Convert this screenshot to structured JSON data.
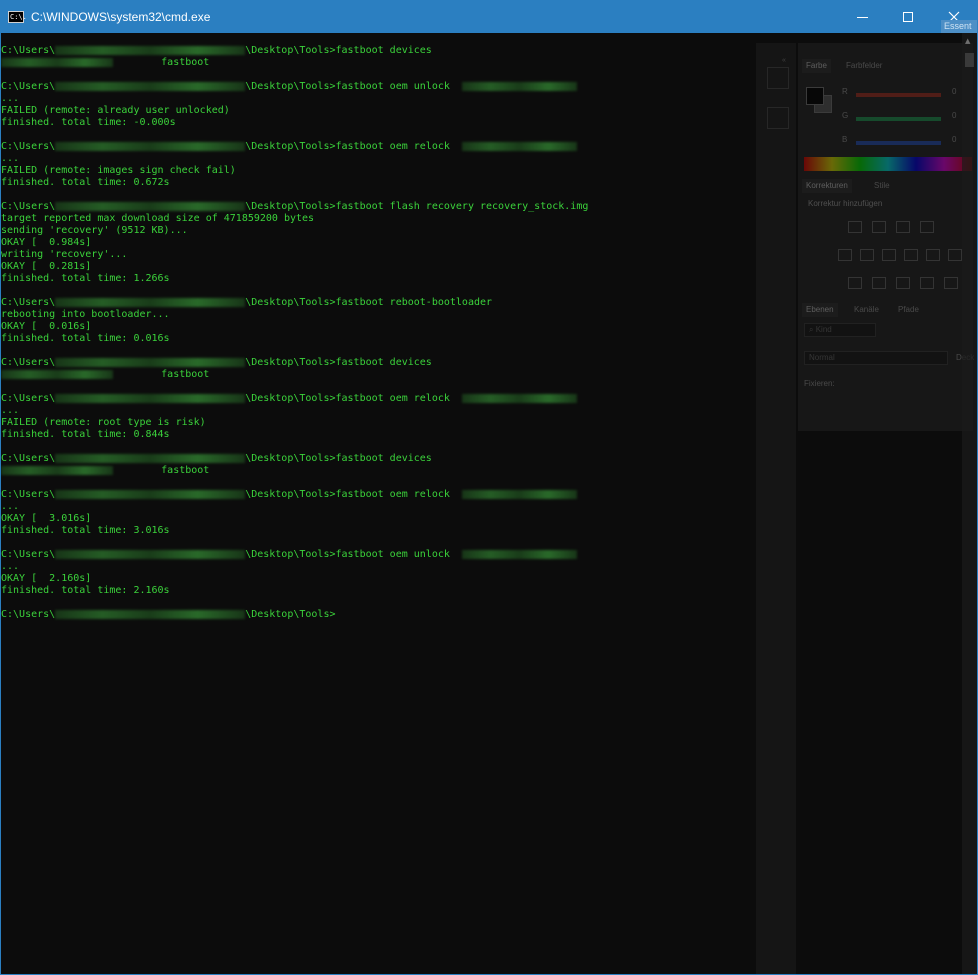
{
  "window": {
    "title": "C:\\WINDOWS\\system32\\cmd.exe",
    "icon_text": "C:\\.",
    "essentials_label": "Essent"
  },
  "terminal": {
    "lines": [
      {
        "parts": [
          {
            "t": "C:\\Users\\"
          },
          {
            "blur": 190
          },
          {
            "t": "\\Desktop\\Tools>fastboot devices"
          }
        ]
      },
      {
        "parts": [
          {
            "blur": 112
          },
          {
            "t": "        fastboot"
          }
        ]
      },
      {
        "parts": []
      },
      {
        "parts": [
          {
            "t": "C:\\Users\\"
          },
          {
            "blur": 190
          },
          {
            "t": "\\Desktop\\Tools>fastboot oem unlock  "
          },
          {
            "blur": 115
          }
        ]
      },
      {
        "parts": [
          {
            "t": "..."
          }
        ]
      },
      {
        "parts": [
          {
            "t": "FAILED (remote: already user unlocked)"
          }
        ]
      },
      {
        "parts": [
          {
            "t": "finished. total time: -0.000s"
          }
        ]
      },
      {
        "parts": []
      },
      {
        "parts": [
          {
            "t": "C:\\Users\\"
          },
          {
            "blur": 190
          },
          {
            "t": "\\Desktop\\Tools>fastboot oem relock  "
          },
          {
            "blur": 115
          }
        ]
      },
      {
        "parts": [
          {
            "t": "..."
          }
        ]
      },
      {
        "parts": [
          {
            "t": "FAILED (remote: images sign check fail)"
          }
        ]
      },
      {
        "parts": [
          {
            "t": "finished. total time: 0.672s"
          }
        ]
      },
      {
        "parts": []
      },
      {
        "parts": [
          {
            "t": "C:\\Users\\"
          },
          {
            "blur": 190
          },
          {
            "t": "\\Desktop\\Tools>fastboot flash recovery recovery_stock.img"
          }
        ]
      },
      {
        "parts": [
          {
            "t": "target reported max download size of 471859200 bytes"
          }
        ]
      },
      {
        "parts": [
          {
            "t": "sending 'recovery' (9512 KB)..."
          }
        ]
      },
      {
        "parts": [
          {
            "t": "OKAY [  0.984s]"
          }
        ]
      },
      {
        "parts": [
          {
            "t": "writing 'recovery'..."
          }
        ]
      },
      {
        "parts": [
          {
            "t": "OKAY [  0.281s]"
          }
        ]
      },
      {
        "parts": [
          {
            "t": "finished. total time: 1.266s"
          }
        ]
      },
      {
        "parts": []
      },
      {
        "parts": [
          {
            "t": "C:\\Users\\"
          },
          {
            "blur": 190
          },
          {
            "t": "\\Desktop\\Tools>fastboot reboot-bootloader"
          }
        ]
      },
      {
        "parts": [
          {
            "t": "rebooting into bootloader..."
          }
        ]
      },
      {
        "parts": [
          {
            "t": "OKAY [  0.016s]"
          }
        ]
      },
      {
        "parts": [
          {
            "t": "finished. total time: 0.016s"
          }
        ]
      },
      {
        "parts": []
      },
      {
        "parts": [
          {
            "t": "C:\\Users\\"
          },
          {
            "blur": 190
          },
          {
            "t": "\\Desktop\\Tools>fastboot devices"
          }
        ]
      },
      {
        "parts": [
          {
            "blur": 112
          },
          {
            "t": "        fastboot"
          }
        ]
      },
      {
        "parts": []
      },
      {
        "parts": [
          {
            "t": "C:\\Users\\"
          },
          {
            "blur": 190
          },
          {
            "t": "\\Desktop\\Tools>fastboot oem relock  "
          },
          {
            "blur": 115
          }
        ]
      },
      {
        "parts": [
          {
            "t": "..."
          }
        ]
      },
      {
        "parts": [
          {
            "t": "FAILED (remote: root type is risk)"
          }
        ]
      },
      {
        "parts": [
          {
            "t": "finished. total time: 0.844s"
          }
        ]
      },
      {
        "parts": []
      },
      {
        "parts": [
          {
            "t": "C:\\Users\\"
          },
          {
            "blur": 190
          },
          {
            "t": "\\Desktop\\Tools>fastboot devices"
          }
        ]
      },
      {
        "parts": [
          {
            "blur": 112
          },
          {
            "t": "        fastboot"
          }
        ]
      },
      {
        "parts": []
      },
      {
        "parts": [
          {
            "t": "C:\\Users\\"
          },
          {
            "blur": 190
          },
          {
            "t": "\\Desktop\\Tools>fastboot oem relock  "
          },
          {
            "blur": 115
          }
        ]
      },
      {
        "parts": [
          {
            "t": "..."
          }
        ]
      },
      {
        "parts": [
          {
            "t": "OKAY [  3.016s]"
          }
        ]
      },
      {
        "parts": [
          {
            "t": "finished. total time: 3.016s"
          }
        ]
      },
      {
        "parts": []
      },
      {
        "parts": [
          {
            "t": "C:\\Users\\"
          },
          {
            "blur": 190
          },
          {
            "t": "\\Desktop\\Tools>fastboot oem unlock  "
          },
          {
            "blur": 115
          }
        ]
      },
      {
        "parts": [
          {
            "t": "..."
          }
        ]
      },
      {
        "parts": [
          {
            "t": "OKAY [  2.160s]"
          }
        ]
      },
      {
        "parts": [
          {
            "t": "finished. total time: 2.160s"
          }
        ]
      },
      {
        "parts": []
      },
      {
        "parts": [
          {
            "t": "C:\\Users\\"
          },
          {
            "blur": 190
          },
          {
            "t": "\\Desktop\\Tools>"
          }
        ]
      }
    ]
  },
  "ghost_panel": {
    "collapse_glyph": "«",
    "tabs_color": [
      "Farbe",
      "Farbfelder"
    ],
    "channels": [
      "R",
      "G",
      "B"
    ],
    "channel_value": "0",
    "tabs_adjust": [
      "Korrekturen",
      "Stile"
    ],
    "adjust_heading": "Korrektur hinzufügen",
    "tabs_layers": [
      "Ebenen",
      "Kanäle",
      "Pfade"
    ],
    "kind_field": "⌕ Kind",
    "blend_field": "Normal",
    "lock_label": "Fixieren:",
    "opacity_label": "Deck",
    "colors": {
      "r": "#c0392b",
      "g": "#27ae60",
      "b": "#2e5fd0"
    }
  }
}
